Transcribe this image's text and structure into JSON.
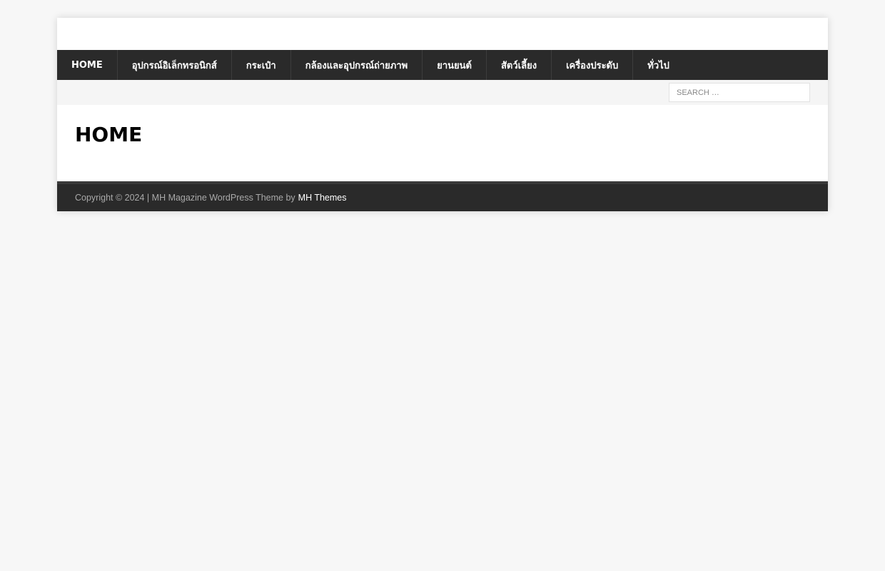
{
  "nav": {
    "items": [
      {
        "label": "HOME"
      },
      {
        "label": "อุปกรณ์อิเล็กทรอนิกส์"
      },
      {
        "label": "กระเป๋า"
      },
      {
        "label": "กล้องและอุปกรณ์ถ่ายภาพ"
      },
      {
        "label": "ยานยนต์"
      },
      {
        "label": "สัตว์เลี้ยง"
      },
      {
        "label": "เครื่องประดับ"
      },
      {
        "label": "ทั่วไป"
      }
    ]
  },
  "search": {
    "placeholder": "SEARCH …"
  },
  "page": {
    "title": "HOME"
  },
  "footer": {
    "copyright": "Copyright © 2024 | MH Magazine WordPress Theme by",
    "link": "MH Themes"
  },
  "colors": {
    "page_background": "#f7f7f7",
    "nav_background": "#2a2a2a",
    "footer_background": "#2a2a2a",
    "subbar_background": "#f5f5f5"
  }
}
